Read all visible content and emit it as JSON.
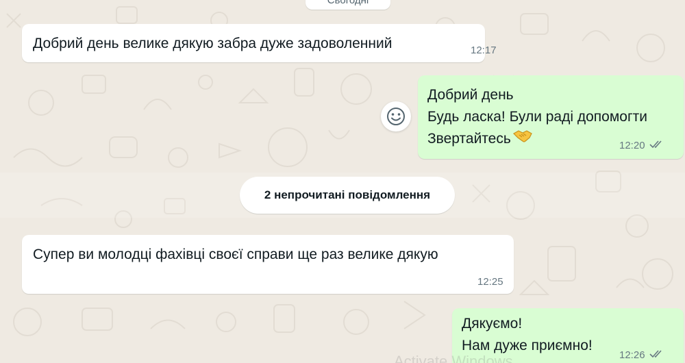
{
  "chat": {
    "date_separator": "Сьогодні",
    "unread_label": "2 непрочитані повідомлення",
    "watermark": "Activate Windows",
    "messages": [
      {
        "direction": "incoming",
        "lines": [
          "Добрий день велике дякую забра дуже задоволенний"
        ],
        "time": "12:17"
      },
      {
        "direction": "outgoing",
        "lines": [
          "Добрий день",
          "Будь ласка! Були раді допомогти",
          "Звертайтесь"
        ],
        "emoji": "handshake-emoji",
        "time": "12:20",
        "status": "read-double-check"
      },
      {
        "direction": "incoming",
        "lines": [
          "Супер ви молодці фахівці своєї справи ще раз велике дякую"
        ],
        "time": "12:25"
      },
      {
        "direction": "outgoing",
        "lines": [
          "Дякуємо!",
          "Нам дуже приємно!"
        ],
        "time": "12:26",
        "status": "read-double-check"
      }
    ]
  },
  "icons": {
    "react": "smiley-icon",
    "status": "double-check-icon"
  },
  "colors": {
    "background": "#efeae2",
    "incoming_bubble": "#ffffff",
    "outgoing_bubble": "#d9fdd3",
    "meta_text": "#667781",
    "primary_text": "#111b21"
  }
}
